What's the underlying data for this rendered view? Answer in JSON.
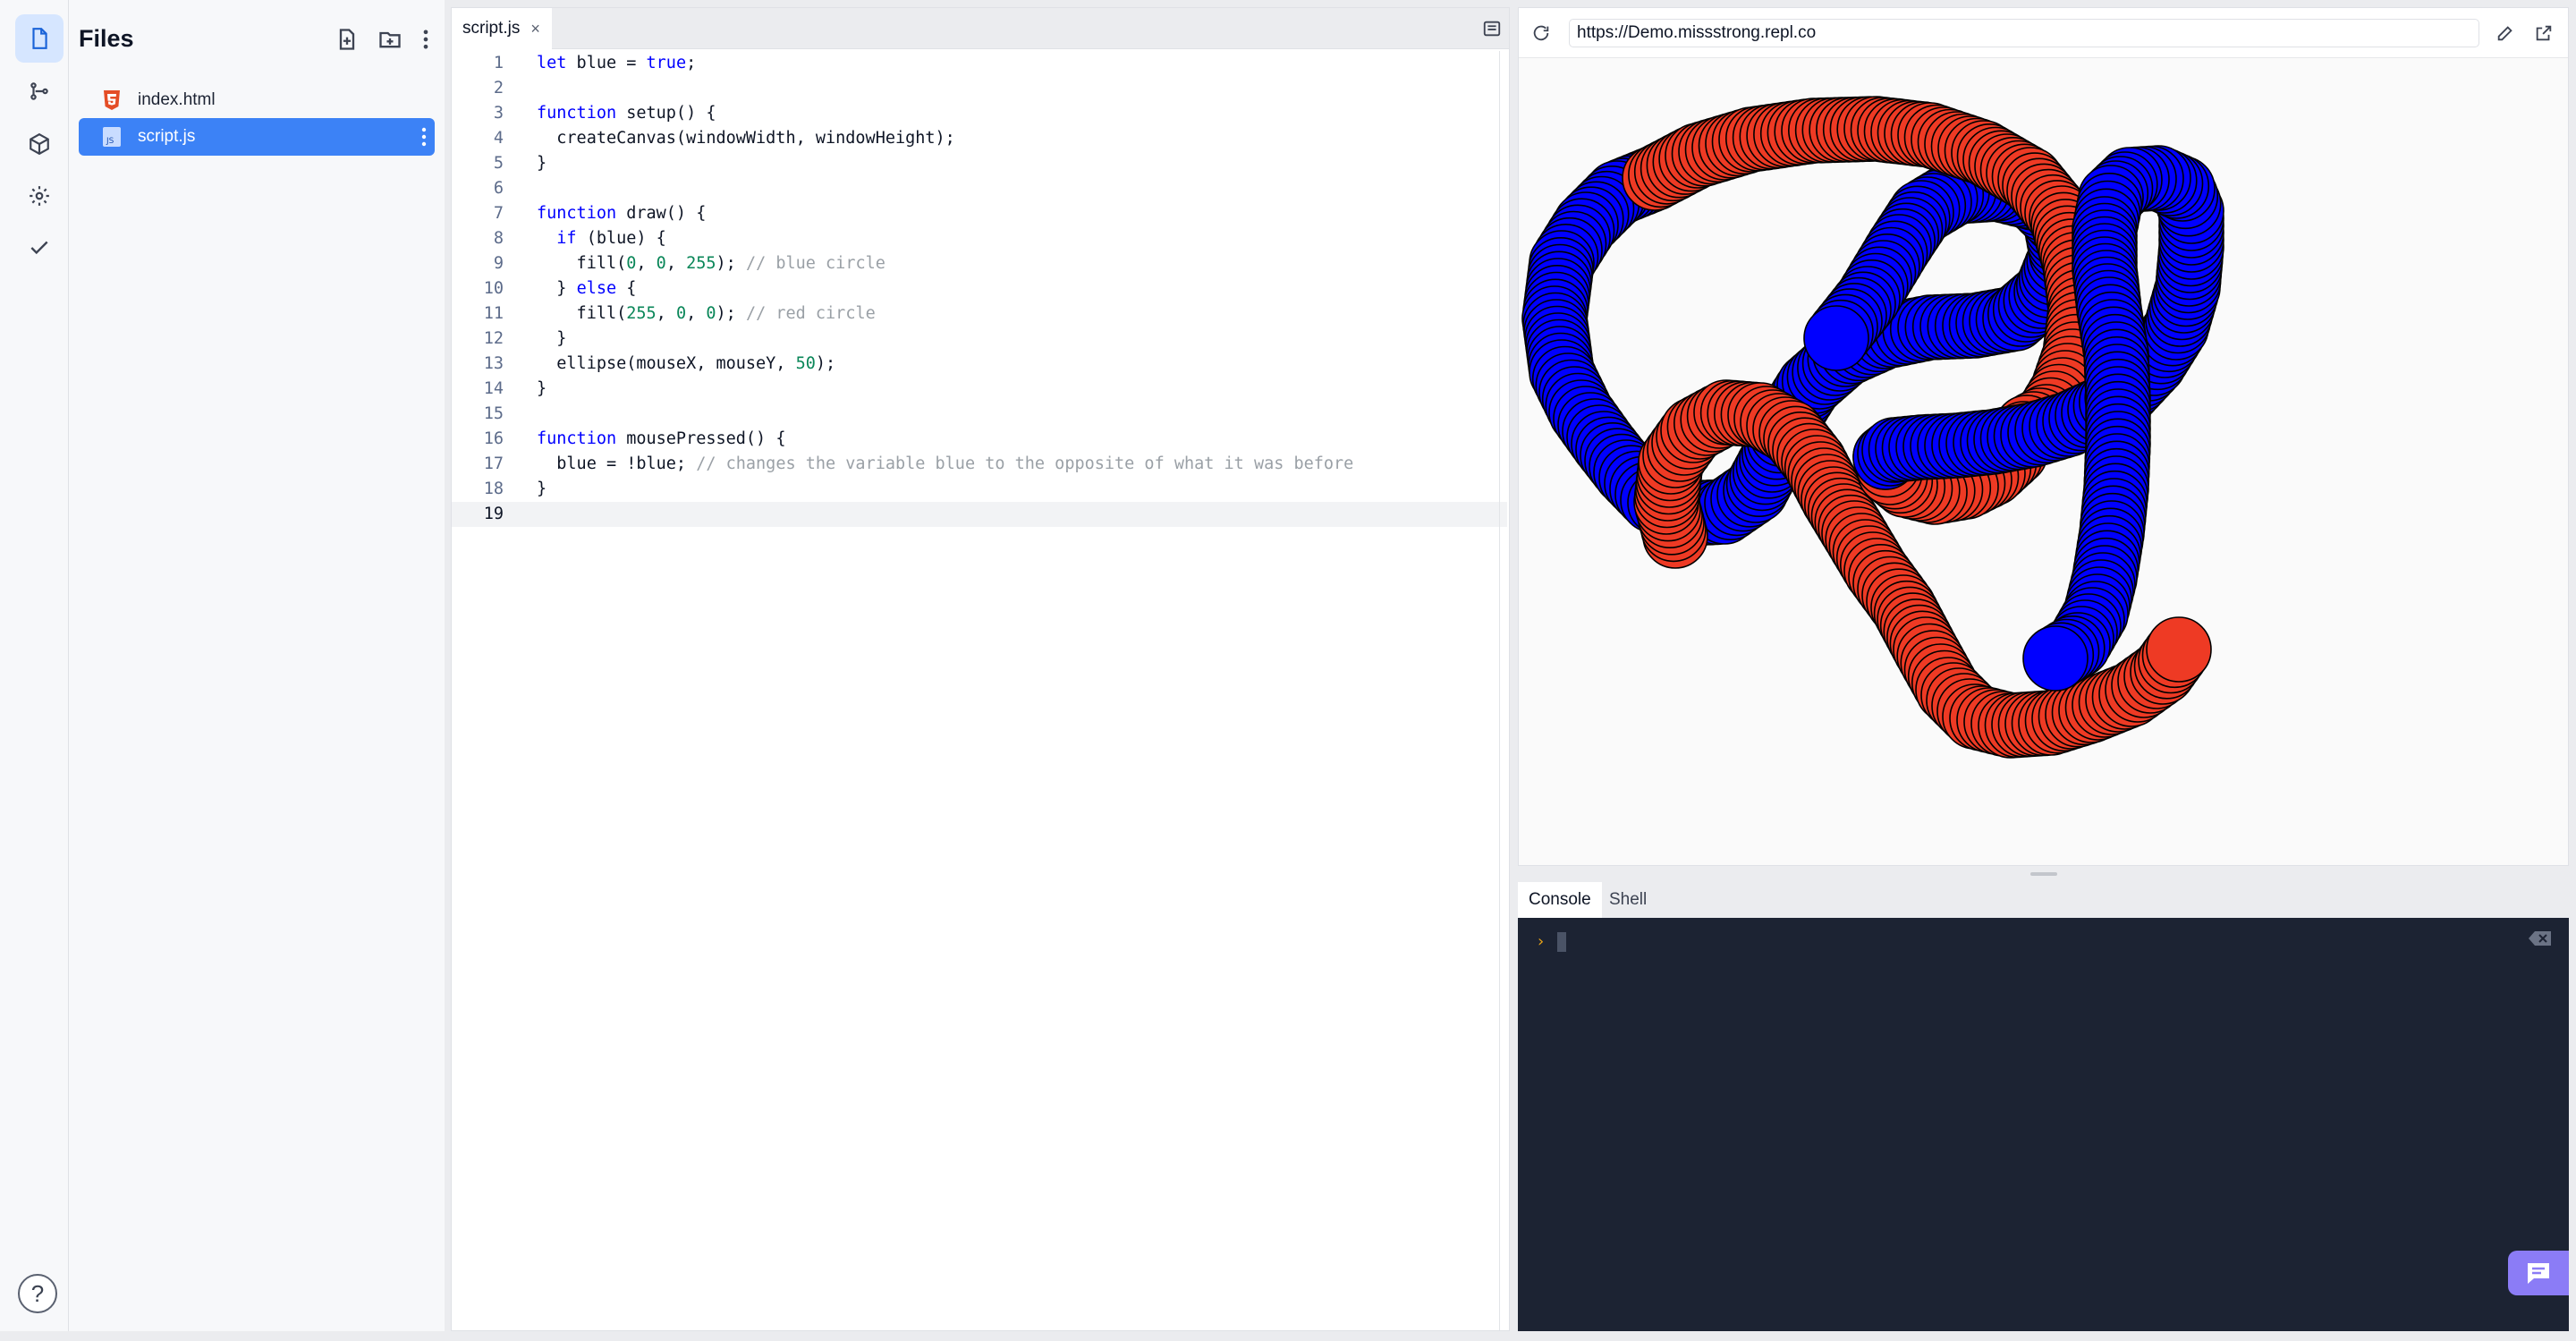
{
  "files_panel": {
    "title": "Files",
    "files": [
      {
        "name": "index.html",
        "icon": "html5-icon"
      },
      {
        "name": "script.js",
        "icon": "js-file-icon",
        "selected": true
      }
    ]
  },
  "editor": {
    "tab_label": "script.js",
    "tab_close": "×",
    "lines": [
      {
        "n": "1",
        "tokens": [
          {
            "t": "let",
            "c": "kw"
          },
          {
            "t": " blue = "
          },
          {
            "t": "true",
            "c": "kw"
          },
          {
            "t": ";"
          }
        ]
      },
      {
        "n": "2",
        "tokens": []
      },
      {
        "n": "3",
        "tokens": [
          {
            "t": "function",
            "c": "kw"
          },
          {
            "t": " setup() {"
          }
        ]
      },
      {
        "n": "4",
        "tokens": [
          {
            "t": "  createCanvas(windowWidth, windowHeight);"
          }
        ]
      },
      {
        "n": "5",
        "tokens": [
          {
            "t": "}"
          }
        ]
      },
      {
        "n": "6",
        "tokens": []
      },
      {
        "n": "7",
        "tokens": [
          {
            "t": "function",
            "c": "kw"
          },
          {
            "t": " draw() {"
          }
        ]
      },
      {
        "n": "8",
        "tokens": [
          {
            "t": "  "
          },
          {
            "t": "if",
            "c": "kw"
          },
          {
            "t": " (blue) {"
          }
        ]
      },
      {
        "n": "9",
        "tokens": [
          {
            "t": "    fill("
          },
          {
            "t": "0",
            "c": "num"
          },
          {
            "t": ", "
          },
          {
            "t": "0",
            "c": "num"
          },
          {
            "t": ", "
          },
          {
            "t": "255",
            "c": "num"
          },
          {
            "t": "); "
          },
          {
            "t": "// blue circle",
            "c": "cm"
          }
        ]
      },
      {
        "n": "10",
        "tokens": [
          {
            "t": "  } "
          },
          {
            "t": "else",
            "c": "kw"
          },
          {
            "t": " {"
          }
        ]
      },
      {
        "n": "11",
        "tokens": [
          {
            "t": "    fill("
          },
          {
            "t": "255",
            "c": "num"
          },
          {
            "t": ", "
          },
          {
            "t": "0",
            "c": "num"
          },
          {
            "t": ", "
          },
          {
            "t": "0",
            "c": "num"
          },
          {
            "t": "); "
          },
          {
            "t": "// red circle",
            "c": "cm"
          }
        ]
      },
      {
        "n": "12",
        "tokens": [
          {
            "t": "  }"
          }
        ]
      },
      {
        "n": "13",
        "tokens": [
          {
            "t": "  ellipse(mouseX, mouseY, "
          },
          {
            "t": "50",
            "c": "num"
          },
          {
            "t": ");"
          }
        ]
      },
      {
        "n": "14",
        "tokens": [
          {
            "t": "}"
          }
        ]
      },
      {
        "n": "15",
        "tokens": []
      },
      {
        "n": "16",
        "tokens": [
          {
            "t": "function",
            "c": "kw"
          },
          {
            "t": " mousePressed() {"
          }
        ]
      },
      {
        "n": "17",
        "tokens": [
          {
            "t": "  blue = !blue; "
          },
          {
            "t": "// changes the variable blue to the opposite of what it was before",
            "c": "cm"
          }
        ]
      },
      {
        "n": "18",
        "tokens": [
          {
            "t": "}"
          }
        ]
      },
      {
        "n": "19",
        "tokens": [],
        "current": true
      }
    ]
  },
  "webview": {
    "url": "https://Demo.missstrong.repl.co",
    "colors": {
      "blue": "#0000ff",
      "red": "#ee3a24",
      "background": "#fafafa"
    }
  },
  "console": {
    "tabs": [
      "Console",
      "Shell"
    ],
    "active_tab": "Console",
    "prompt": "›"
  },
  "help_label": "?"
}
